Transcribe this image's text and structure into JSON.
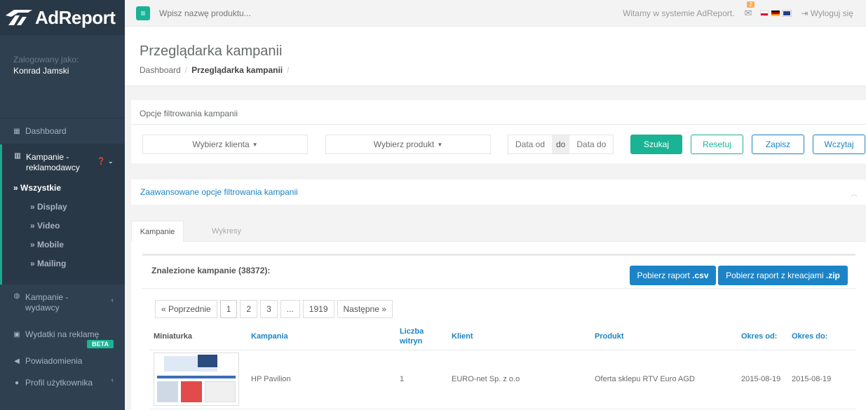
{
  "brand": {
    "name": "AdReport"
  },
  "profile": {
    "label": "Zalogowany jako:",
    "name": "Konrad Jamski"
  },
  "nav": {
    "dashboard": "Dashboard",
    "campaigns_adv": "Kampanie - reklamodawcy",
    "sub": [
      "» Wszystkie",
      "» Display",
      "» Video",
      "» Mobile",
      "» Mailing"
    ],
    "campaigns_pub": "Kampanie - wydawcy",
    "spend": "Wydatki na reklamę",
    "beta": "BETA",
    "notifications": "Powiadomienia",
    "profile": "Profil użytkownika"
  },
  "topbar": {
    "search_placeholder": "Wpisz nazwę produktu...",
    "welcome": "Witamy w systemie AdReport.",
    "mail_count": "2",
    "logout": "Wyloguj się"
  },
  "header": {
    "title": "Przeglądarka kampanii",
    "crumb_home": "Dashboard",
    "crumb_current": "Przeglądarka kampanii"
  },
  "filters": {
    "title": "Opcje filtrowania kampanii",
    "client": "Wybierz klienta",
    "product": "Wybierz produkt",
    "date_from": "Data od",
    "date_sep": "do",
    "date_to": "Data do",
    "search": "Szukaj",
    "reset": "Resetuj",
    "save": "Zapisz",
    "load": "Wczytaj"
  },
  "advanced": {
    "title": "Zaawansowane opcje filtrowania kampanii"
  },
  "tabs": {
    "campaigns": "Kampanie",
    "charts": "Wykresy"
  },
  "results": {
    "found": "Znalezione kampanie (38372):",
    "csv_prefix": "Pobierz raport ",
    "csv_ext": ".csv",
    "zip_prefix": "Pobierz raport z kreacjami ",
    "zip_ext": ".zip"
  },
  "pagination": {
    "prev": "« Poprzednie",
    "pages": [
      "1",
      "2",
      "3",
      "...",
      "1919"
    ],
    "next": "Następne »"
  },
  "table": {
    "headers": {
      "thumb": "Miniaturka",
      "campaign": "Kampania",
      "sites": "Liczba witryn",
      "client": "Klient",
      "product": "Produkt",
      "from": "Okres od:",
      "to": "Okres do:"
    },
    "rows": [
      {
        "campaign": "HP Pavilion",
        "sites": "1",
        "client": "EURO-net Sp. z o.o",
        "product": "Oferta sklepu RTV Euro AGD",
        "from": "2015-08-19",
        "to": "2015-08-19"
      }
    ]
  },
  "colors": {
    "sidebar": "#2f4050",
    "accent": "#1ab394",
    "link": "#1c84c6"
  }
}
